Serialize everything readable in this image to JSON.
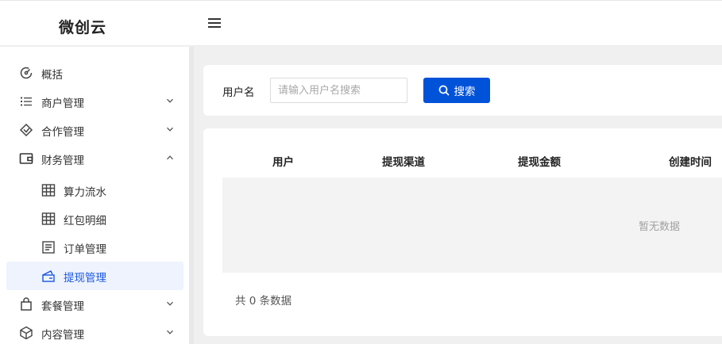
{
  "header": {
    "brand": "微创云",
    "menu_icon": "hamburger-icon"
  },
  "sidebar": {
    "items": [
      {
        "label": "概括",
        "icon": "dashboard-gauge-icon",
        "expandable": false
      },
      {
        "label": "商户管理",
        "icon": "list-icon",
        "expandable": true,
        "expanded": false
      },
      {
        "label": "合作管理",
        "icon": "handshake-icon",
        "expandable": true,
        "expanded": false
      },
      {
        "label": "财务管理",
        "icon": "wallet-icon",
        "expandable": true,
        "expanded": true,
        "children": [
          {
            "label": "算力流水",
            "icon": "table-grid-icon"
          },
          {
            "label": "红包明细",
            "icon": "table-grid-icon"
          },
          {
            "label": "订单管理",
            "icon": "document-list-icon"
          },
          {
            "label": "提现管理",
            "icon": "card-withdraw-icon",
            "active": true
          }
        ]
      },
      {
        "label": "套餐管理",
        "icon": "shopping-bag-icon",
        "expandable": true,
        "expanded": false
      },
      {
        "label": "内容管理",
        "icon": "cube-icon",
        "expandable": true,
        "expanded": false
      }
    ]
  },
  "search": {
    "label": "用户名",
    "placeholder": "请输入用户名搜索",
    "value": "",
    "button_label": "搜索",
    "button_icon": "search-icon"
  },
  "table": {
    "columns": [
      "用户",
      "提现渠道",
      "提现金额",
      "创建时间"
    ],
    "rows": [],
    "empty_text": "暂无数据",
    "total_text": "共 0 条数据"
  },
  "colors": {
    "primary": "#0052d9",
    "active_bg": "#eef3fd",
    "active_text": "#1a56e0",
    "page_bg": "#f0f0f0"
  }
}
